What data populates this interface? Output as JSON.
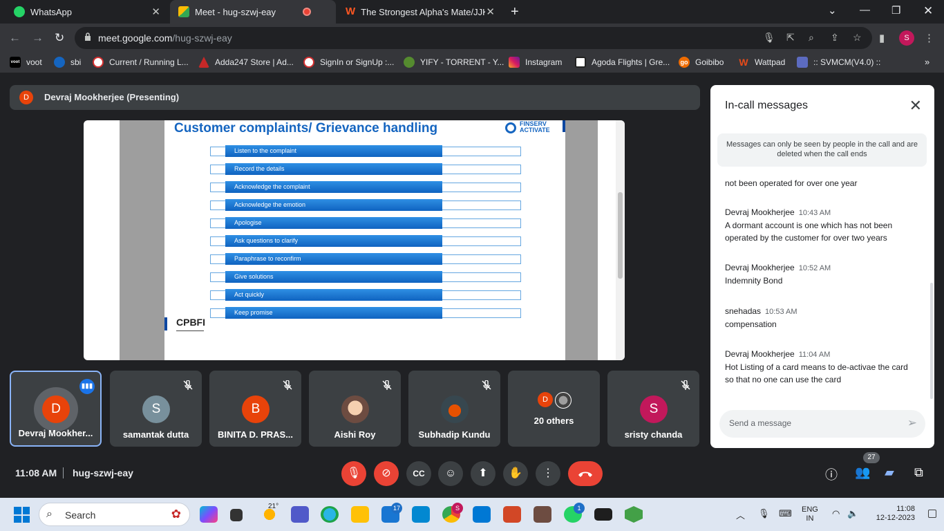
{
  "browser": {
    "tabs": [
      {
        "title": "WhatsApp",
        "icon": "whatsapp-icon"
      },
      {
        "title": "Meet - hug-szwj-eay",
        "icon": "meet-icon"
      },
      {
        "title": "The Strongest Alpha's Mate/JJK",
        "icon": "wattpad-icon"
      }
    ],
    "url_host": "meet.google.com",
    "url_path": "/hug-szwj-eay",
    "profile_initial": "S",
    "bookmarks": [
      "voot",
      "sbi",
      "Current / Running L...",
      "Adda247 Store | Ad...",
      "SignIn or SignUp :...",
      "YIFY - TORRENT - Y...",
      "Instagram",
      "Agoda Flights | Gre...",
      "Goibibo",
      "Wattpad",
      ":: SVMCM(V4.0) ::"
    ],
    "bookmark_icon_text": [
      "voot",
      "",
      "",
      "",
      "",
      "",
      "",
      "",
      "go",
      "W",
      ""
    ],
    "bookmark_colors": [
      "#000000",
      "#1565c0",
      "#d32f2f",
      "#c62828",
      "#d32f2f",
      "#558b2f",
      "#d81b60",
      "#222222",
      "#ef6c00",
      "#e64a19",
      "#5c6bc0"
    ]
  },
  "meet": {
    "presenter": {
      "initial": "D",
      "label": "Devraj Mookherjee (Presenting)"
    },
    "slide": {
      "title": "Customer complaints/ Grievance handling",
      "brand_line1": "FINSERV",
      "brand_line2": "ACTIVATE",
      "steps": [
        "Listen to the complaint",
        "Record the details",
        "Acknowledge the complaint",
        "Acknowledge the emotion",
        "Apologise",
        "Ask questions to clarify",
        "Paraphrase to reconfirm",
        "Give solutions",
        "Act quickly",
        "Keep promise"
      ],
      "footer_logo": "CPBFI"
    },
    "participants": [
      {
        "name": "Devraj Mookher...",
        "initial": "D",
        "color": "#e8430a",
        "speaking": true
      },
      {
        "name": "samantak dutta",
        "initial": "S",
        "color": "#78909c"
      },
      {
        "name": "BINITA D. PRAS...",
        "initial": "B",
        "color": "#e8430a"
      },
      {
        "name": "Aishi Roy",
        "initial": "",
        "color": "#d7a67f"
      },
      {
        "name": "Subhadip Kundu",
        "initial": "",
        "color": "#e65100"
      },
      {
        "name": "20 others",
        "initial": "D",
        "color": "#e8430a"
      },
      {
        "name": "sristy chanda",
        "initial": "S",
        "color": "#c2185b"
      }
    ],
    "chat": {
      "title": "In-call messages",
      "notice": "Messages can only be seen by people in the call and are deleted when the call ends",
      "partial_message": "not been operated for over one year",
      "messages": [
        {
          "sender": "Devraj Mookherjee",
          "time": "10:43 AM",
          "text": "A dormant account is one which has not been operated by the customer for over two years"
        },
        {
          "sender": "Devraj Mookherjee",
          "time": "10:52 AM",
          "text": "Indemnity Bond"
        },
        {
          "sender": "snehadas",
          "time": "10:53 AM",
          "text": "compensation"
        },
        {
          "sender": "Devraj Mookherjee",
          "time": "11:04 AM",
          "text": "Hot Listing of a card means to de-activae the card so that no one can use the card"
        }
      ],
      "input_placeholder": "Send a message"
    },
    "bottom": {
      "time": "11:08 AM",
      "code": "hug-szwj-eay",
      "people_count": "27"
    }
  },
  "taskbar": {
    "search_label": "Search",
    "weather": "21°",
    "mail_badge": "17",
    "whatsapp_badge": "1",
    "chrome_badge": "S",
    "lang_line1": "ENG",
    "lang_line2": "IN",
    "time": "11:08",
    "date": "12-12-2023"
  }
}
